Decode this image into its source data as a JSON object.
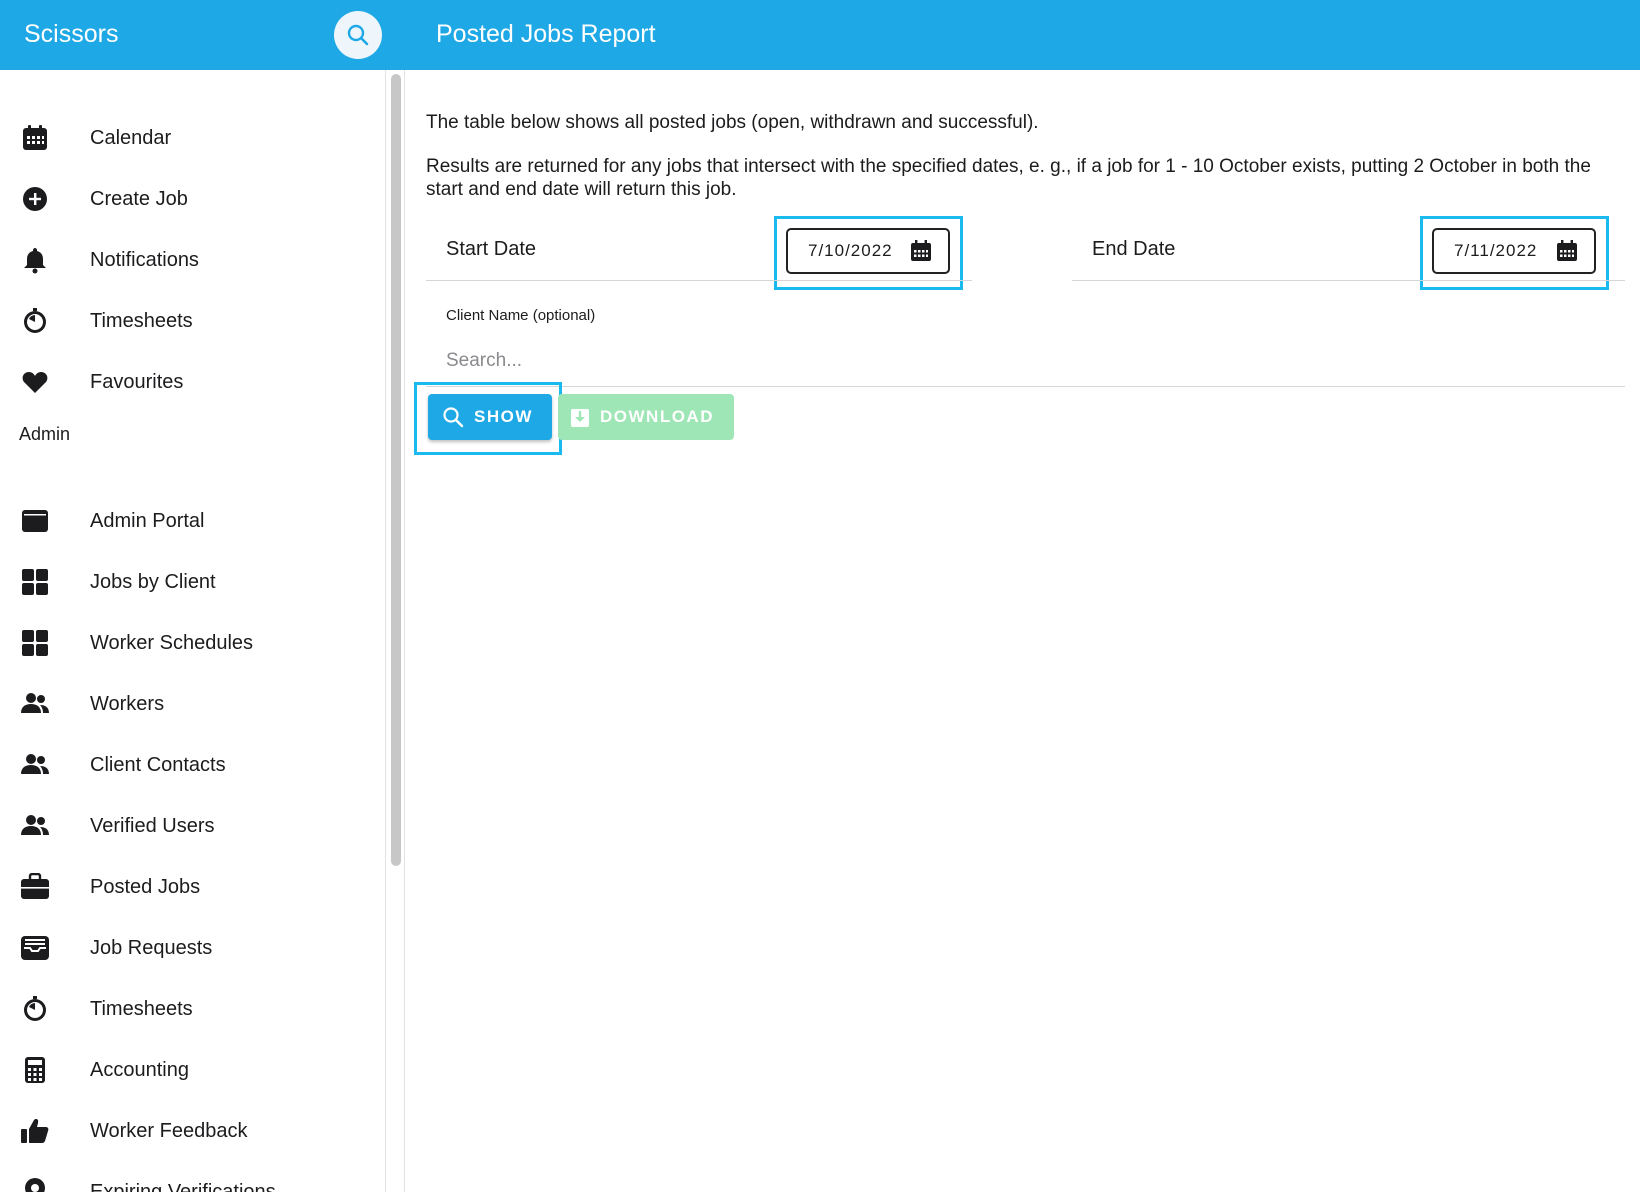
{
  "header": {
    "app_title": "Scissors",
    "page_title": "Posted Jobs Report"
  },
  "sidebar": {
    "items": [
      {
        "label": "Calendar",
        "icon": "calendar-icon"
      },
      {
        "label": "Create Job",
        "icon": "plus-circle-icon"
      },
      {
        "label": "Notifications",
        "icon": "bell-icon"
      },
      {
        "label": "Timesheets",
        "icon": "stopwatch-icon"
      },
      {
        "label": "Favourites",
        "icon": "heart-icon"
      }
    ],
    "admin_label": "Admin",
    "admin_items": [
      {
        "label": "Admin Portal",
        "icon": "window-icon"
      },
      {
        "label": "Jobs by Client",
        "icon": "grid-icon"
      },
      {
        "label": "Worker Schedules",
        "icon": "grid-icon"
      },
      {
        "label": "Workers",
        "icon": "users-icon"
      },
      {
        "label": "Client Contacts",
        "icon": "users-icon"
      },
      {
        "label": "Verified Users",
        "icon": "users-icon"
      },
      {
        "label": "Posted Jobs",
        "icon": "briefcase-icon"
      },
      {
        "label": "Job Requests",
        "icon": "inbox-icon"
      },
      {
        "label": "Timesheets",
        "icon": "stopwatch-icon"
      },
      {
        "label": "Accounting",
        "icon": "calculator-icon"
      },
      {
        "label": "Worker Feedback",
        "icon": "thumbs-up-icon"
      },
      {
        "label": "Expiring Verifications",
        "icon": "award-icon"
      }
    ]
  },
  "main": {
    "intro_line1": "The table below shows all posted jobs (open, withdrawn and successful).",
    "intro_line2": "Results are returned for any jobs that intersect with the specified dates, e. g., if a job for 1 - 10 October exists, putting 2 October in both the start and end date will return this job.",
    "start_date_label": "Start Date",
    "start_date_value": "7/10/2022",
    "end_date_label": "End Date",
    "end_date_value": "7/11/2022",
    "client_label": "Client Name (optional)",
    "client_placeholder": "Search...",
    "show_label": "SHOW",
    "download_label": "DOWNLOAD"
  },
  "colors": {
    "primary": "#1ea8e6",
    "highlight": "#1ab9ee",
    "download_disabled": "#9ee6b5"
  }
}
